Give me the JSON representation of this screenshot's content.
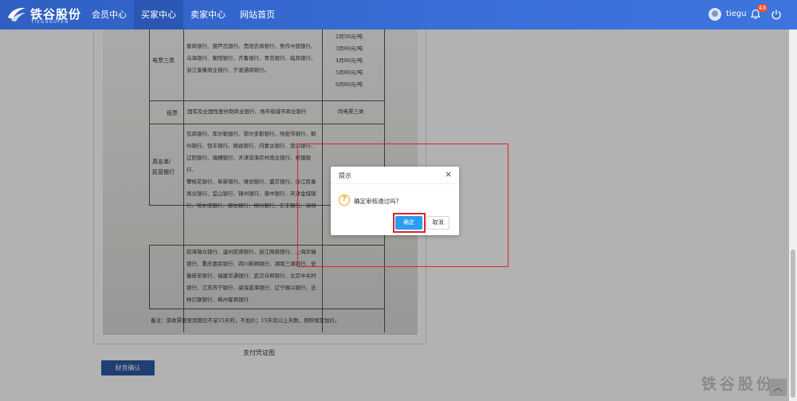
{
  "brand": {
    "name": "铁谷股份",
    "pinyin": "TIEGUGUFEN",
    "accent": "#3a6fd8"
  },
  "nav": {
    "items": [
      {
        "label": "会员中心",
        "active": false
      },
      {
        "label": "买家中心",
        "active": true
      },
      {
        "label": "卖家中心",
        "active": false
      },
      {
        "label": "网站首页",
        "active": false
      }
    ]
  },
  "user": {
    "name": "tiegu",
    "notifications": "43"
  },
  "doc": {
    "row1_label": "电票三类",
    "row1_banks": "晋商银行、葫芦岛银行、贵阳农商银行、焦作中旅银行、\n乌海银行、衡阳银行、齐鲁银行、青岛银行、临商银行、\n浙江泰隆商业银行、宁波通商银行。",
    "row1_rates": "2月50元/吨\n3月60元/吨\n4月80元/吨\n5月80元/吨\n6月80元/吨",
    "row2_label": "纸票",
    "row2_banks": "国有及全国性股份制商业银行、地市级城市商业银行",
    "row2_note": "同电票三类",
    "row3_label": "真名单/\n民营银行",
    "row3_banks": "包商银行、库尔勒银行、鄂尔多斯银行、哈密市银行、鹤\n州银行、恒丰银行、朔县银行、内蒙古银行、营口银行、\n辽阳银行、瑞穗银行、天津滨海农村商业银行、村镇银行、\n攀枝花银行、阜新银行、潍坊银行、盛京银行、浙江民泰\n商业银行、宜山银行、锦州银行、晋中银行、天津金城银\n行、哈尔滨银行、廊坊银行、柳州银行、汇丰银行、深圳",
    "row4_banks": "前海微众银行、温州民商银行、浙江网商银行、上海华瑞\n银行、重庆富民银行、四川新网银行、湖南三湘银行、安\n徽新安银行、福建华通银行、武汉众邦银行、北京中关村\n银行、江苏苏宁银行、威海蓝海银行、辽宁振兴银行、吉\n林亿联银行、梅州客商银行",
    "remark": "备注：该收票据至到期日不足15天的，不加价；15天及以上天数，按照规定加价。"
  },
  "caption": "支付凭证图",
  "finance_button": "财务确认",
  "watermark": "铁谷股份",
  "dialog": {
    "title": "提示",
    "message": "确定审核通过吗?",
    "ok": "确定",
    "cancel": "取消",
    "close_glyph": "×",
    "warn_glyph": "?"
  },
  "scroll_top_glyph": "︿",
  "colors": {
    "annotation": "#d9262c",
    "ok_button": "#2b9cf0",
    "finance_button": "#2e5aa6"
  }
}
